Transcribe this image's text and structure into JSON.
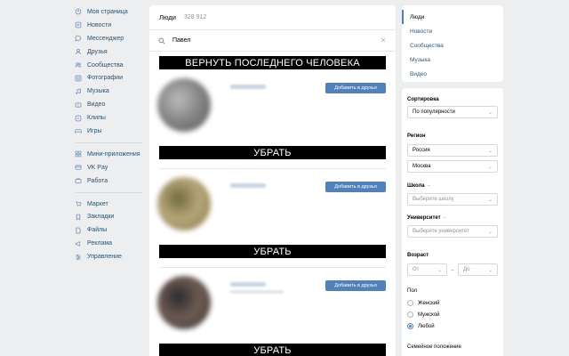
{
  "nav": {
    "group1": [
      {
        "icon": "home-icon",
        "label": "Моя страница"
      },
      {
        "icon": "news-icon",
        "label": "Новости"
      },
      {
        "icon": "message-icon",
        "label": "Мессенджер"
      },
      {
        "icon": "friends-icon",
        "label": "Друзья"
      },
      {
        "icon": "communities-icon",
        "label": "Сообщества"
      },
      {
        "icon": "photo-icon",
        "label": "Фотографии"
      },
      {
        "icon": "music-icon",
        "label": "Музыка"
      },
      {
        "icon": "video-icon",
        "label": "Видео"
      },
      {
        "icon": "clips-icon",
        "label": "Клипы"
      },
      {
        "icon": "games-icon",
        "label": "Игры"
      }
    ],
    "group2": [
      {
        "icon": "apps-icon",
        "label": "Мини-приложения"
      },
      {
        "icon": "vkpay-icon",
        "label": "VK Pay"
      },
      {
        "icon": "work-icon",
        "label": "Работа"
      }
    ],
    "group3": [
      {
        "icon": "market-icon",
        "label": "Маркет"
      },
      {
        "icon": "bookmark-icon",
        "label": "Закладки"
      },
      {
        "icon": "files-icon",
        "label": "Файлы"
      },
      {
        "icon": "ads-icon",
        "label": "Реклама"
      },
      {
        "icon": "manage-icon",
        "label": "Управление"
      }
    ]
  },
  "main": {
    "title": "Люди",
    "count": "328 912",
    "search_value": "Павел",
    "clear_symbol": "✕",
    "top_banner": "ВЕРНУТЬ ПОСЛЕДНЕГО ЧЕЛОВЕКА",
    "remove_label": "УБРАТЬ",
    "add_friend_label": "Добавить в друзья",
    "people": [
      {
        "avatar_colors": [
          "#555",
          "#888",
          "#bbb"
        ],
        "has_sub": false
      },
      {
        "avatar_colors": [
          "#8a7a4a",
          "#b5a679",
          "#6f6b3c"
        ],
        "has_sub": false
      },
      {
        "avatar_colors": [
          "#3e3a38",
          "#6d5a52",
          "#2b2b2e"
        ],
        "has_sub": true
      }
    ]
  },
  "tabs": [
    {
      "label": "Люди",
      "active": true
    },
    {
      "label": "Новости",
      "active": false
    },
    {
      "label": "Сообщества",
      "active": false
    },
    {
      "label": "Музыка",
      "active": false
    },
    {
      "label": "Видео",
      "active": false
    }
  ],
  "filters": {
    "sort_label": "Сортировка",
    "sort_value": "По популярности",
    "region_label": "Регион",
    "country_value": "Россия",
    "city_value": "Москва",
    "school_label": "Школа",
    "school_placeholder": "Выберите школу",
    "university_label": "Университет",
    "university_placeholder": "Выберите университет",
    "age_label": "Возраст",
    "age_from": "От",
    "age_to": "До",
    "age_dash": "–",
    "gender_label": "Пол",
    "gender_options": [
      {
        "label": "Женский",
        "checked": false
      },
      {
        "label": "Мужской",
        "checked": false
      },
      {
        "label": "Любой",
        "checked": true
      }
    ],
    "marital_label": "Семейное положение",
    "label_dash": "–",
    "chevron": "⌄"
  },
  "colors": {
    "accent": "#5181b8",
    "link": "#2a5885",
    "background": "#edeef0"
  }
}
